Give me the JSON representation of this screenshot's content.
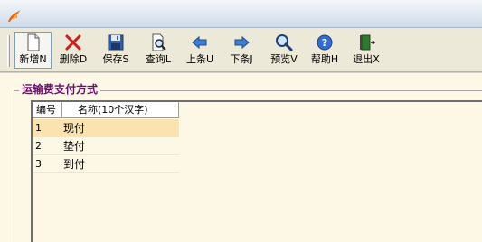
{
  "toolbar": {
    "buttons": [
      {
        "label": "新增N",
        "icon": "new-document-icon"
      },
      {
        "label": "删除D",
        "icon": "delete-x-icon"
      },
      {
        "label": "保存S",
        "icon": "save-floppy-icon"
      },
      {
        "label": "查询L",
        "icon": "query-magnifier-document-icon"
      },
      {
        "label": "上条U",
        "icon": "arrow-left-icon"
      },
      {
        "label": "下条J",
        "icon": "arrow-right-icon"
      },
      {
        "label": "预览V",
        "icon": "preview-magnifier-icon"
      },
      {
        "label": "帮助H",
        "icon": "help-icon"
      },
      {
        "label": "退出X",
        "icon": "exit-door-icon"
      }
    ]
  },
  "group": {
    "title": "运输费支付方式"
  },
  "grid": {
    "columns": [
      "编号",
      "名称(10个汉字)"
    ],
    "rows": [
      {
        "id": "1",
        "name": "现付"
      },
      {
        "id": "2",
        "name": "垫付"
      },
      {
        "id": "3",
        "name": "到付"
      }
    ]
  },
  "colors": {
    "group_title": "#6b0a70",
    "selected_row": "#fbe3b0",
    "content_bg": "#fdf7e6"
  }
}
